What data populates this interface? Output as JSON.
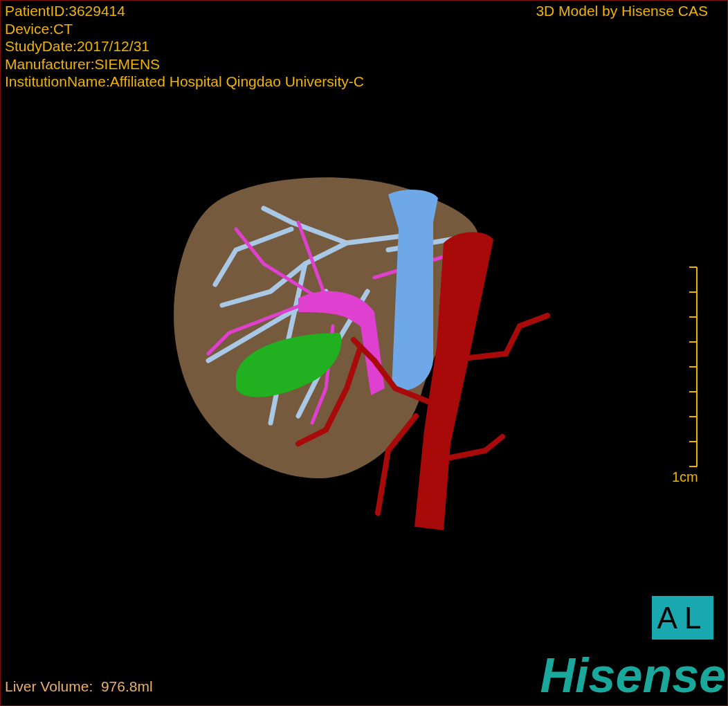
{
  "info_lines": [
    "PatientID:3629414",
    "Device:CT",
    "StudyDate:2017/12/31",
    "Manufacturer:SIEMENS",
    "InstitutionName:Affiliated Hospital Qingdao University-C"
  ],
  "title": "3D Model by Hisense CAS",
  "scale": {
    "label": "1cm"
  },
  "orientation": {
    "label": "AL"
  },
  "liver_volume": "Liver Volume:  976.8ml",
  "logo": "Hisense"
}
